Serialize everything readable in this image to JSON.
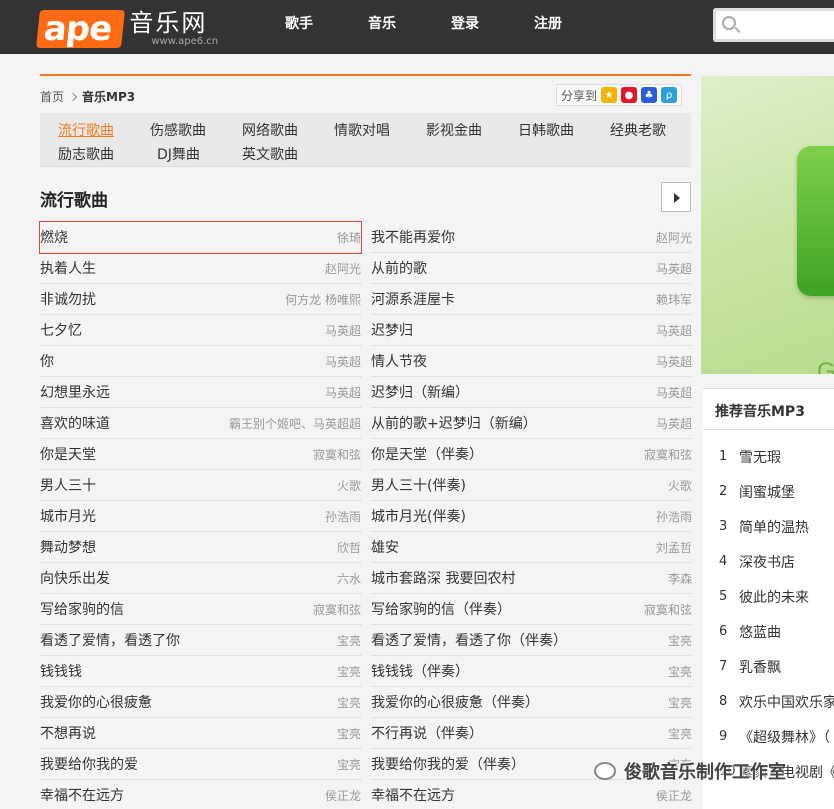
{
  "site": {
    "logo_mark": "ape",
    "logo_title": "音乐网",
    "logo_url": "www.ape6.cn"
  },
  "nav": {
    "items": [
      "歌手",
      "音乐",
      "登录",
      "注册"
    ],
    "separator": "|"
  },
  "breadcrumb": {
    "home": "首页",
    "current": "音乐MP3"
  },
  "share": {
    "label": "分享到"
  },
  "categories": {
    "row1": [
      "流行歌曲",
      "伤感歌曲",
      "网络歌曲",
      "情歌对唱",
      "影视金曲",
      "日韩歌曲",
      "经典老歌"
    ],
    "row2": [
      "励志歌曲",
      "DJ舞曲",
      "英文歌曲"
    ],
    "active": "流行歌曲"
  },
  "section": {
    "title": "流行歌曲"
  },
  "songs_left": [
    {
      "title": "燃烧",
      "artist": "徐琦"
    },
    {
      "title": "执着人生",
      "artist": "赵阿光"
    },
    {
      "title": "非诚勿扰",
      "artist": "何方龙 杨唯熙"
    },
    {
      "title": "七夕忆",
      "artist": "马英超"
    },
    {
      "title": "你",
      "artist": "马英超"
    },
    {
      "title": "幻想里永远",
      "artist": "马英超"
    },
    {
      "title": "喜欢的味道",
      "artist": "霸王别个姬吧、马英超超"
    },
    {
      "title": "你是天堂",
      "artist": "寂寞和弦"
    },
    {
      "title": "男人三十",
      "artist": "火歌"
    },
    {
      "title": "城市月光",
      "artist": "孙浩雨"
    },
    {
      "title": "舞动梦想",
      "artist": "欣哲"
    },
    {
      "title": "向快乐出发",
      "artist": "六水"
    },
    {
      "title": "写给家驹的信",
      "artist": "寂寞和弦"
    },
    {
      "title": "看透了爱情，看透了你",
      "artist": "宝亮"
    },
    {
      "title": "钱钱钱",
      "artist": "宝亮"
    },
    {
      "title": "我爱你的心很疲惫",
      "artist": "宝亮"
    },
    {
      "title": "不想再说",
      "artist": "宝亮"
    },
    {
      "title": "我要给你我的爱",
      "artist": "宝亮"
    },
    {
      "title": "幸福不在远方",
      "artist": "侯正龙"
    }
  ],
  "songs_right": [
    {
      "title": "我不能再爱你",
      "artist": "赵阿光"
    },
    {
      "title": "从前的歌",
      "artist": "马英超"
    },
    {
      "title": "河源系涯屋卡",
      "artist": "赖玮军"
    },
    {
      "title": "迟梦归",
      "artist": "马英超"
    },
    {
      "title": "情人节夜",
      "artist": "马英超"
    },
    {
      "title": "迟梦归（新编）",
      "artist": "马英超"
    },
    {
      "title": "从前的歌+迟梦归（新编）",
      "artist": "马英超"
    },
    {
      "title": "你是天堂（伴奏）",
      "artist": "寂寞和弦"
    },
    {
      "title": "男人三十(伴奏)",
      "artist": "火歌"
    },
    {
      "title": "城市月光(伴奏)",
      "artist": "孙浩雨"
    },
    {
      "title": "雄安",
      "artist": "刘孟哲"
    },
    {
      "title": "城市套路深 我要回农村",
      "artist": "李森"
    },
    {
      "title": "写给家驹的信（伴奏）",
      "artist": "寂寞和弦"
    },
    {
      "title": "看透了爱情，看透了你（伴奏）",
      "artist": "宝亮"
    },
    {
      "title": "钱钱钱（伴奏）",
      "artist": "宝亮"
    },
    {
      "title": "我爱你的心很疲惫（伴奏）",
      "artist": "宝亮"
    },
    {
      "title": "不行再说（伴奏）",
      "artist": "宝亮"
    },
    {
      "title": "我要给你我的爱（伴奏）",
      "artist": "宝亮"
    },
    {
      "title": "幸福不在远方",
      "artist": "侯正龙"
    }
  ],
  "recommend": {
    "title": "推荐音乐MP3",
    "items": [
      {
        "num": "1",
        "title": "雪无瑕"
      },
      {
        "num": "2",
        "title": "闺蜜城堡"
      },
      {
        "num": "3",
        "title": "简单的温热"
      },
      {
        "num": "4",
        "title": "深夜书店"
      },
      {
        "num": "5",
        "title": "彼此的未来"
      },
      {
        "num": "6",
        "title": "悠蓝曲"
      },
      {
        "num": "7",
        "title": "乳香飘"
      },
      {
        "num": "8",
        "title": "欢乐中国欢乐家"
      },
      {
        "num": "9",
        "title": "《超级舞林》（"
      },
      {
        "num": "10",
        "title": "素颜（电视剧《"
      }
    ]
  },
  "watermark": {
    "text": "俊歌音乐制作工作室"
  },
  "colors": {
    "accent": "#f57a20",
    "topbar": "#333333",
    "highlight_border": "#e0463a"
  }
}
